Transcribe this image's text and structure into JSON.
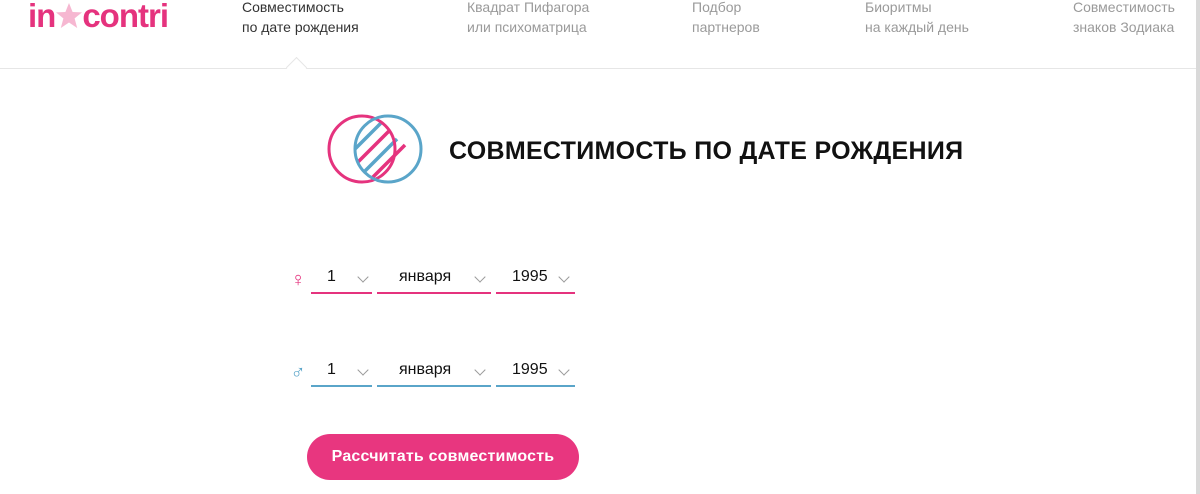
{
  "brand": {
    "logo_left": "in",
    "logo_right": "contri",
    "accent": "#e5337e",
    "secondary": "#5aa5c9"
  },
  "nav": {
    "items": [
      {
        "line1": "Совместимость",
        "line2": "по дате рождения",
        "active": true
      },
      {
        "line1": "Квадрат Пифагора",
        "line2": "или психоматрица",
        "active": false
      },
      {
        "line1": "Подбор",
        "line2": "партнеров",
        "active": false
      },
      {
        "line1": "Биоритмы",
        "line2": "на каждый день",
        "active": false
      },
      {
        "line1": "Совместимость",
        "line2": "знаков Зодиака",
        "active": false
      }
    ]
  },
  "main": {
    "title": "СОВМЕСТИМОСТЬ ПО ДАТЕ РОЖДЕНИЯ",
    "title_icon": "overlapping-circles-icon"
  },
  "female": {
    "icon": "♀",
    "icon_name": "female-symbol-icon",
    "day": "1",
    "month": "января",
    "year": "1995"
  },
  "male": {
    "icon": "♂",
    "icon_name": "male-symbol-icon",
    "day": "1",
    "month": "января",
    "year": "1995"
  },
  "cta": {
    "label": "Рассчитать совместимость"
  }
}
